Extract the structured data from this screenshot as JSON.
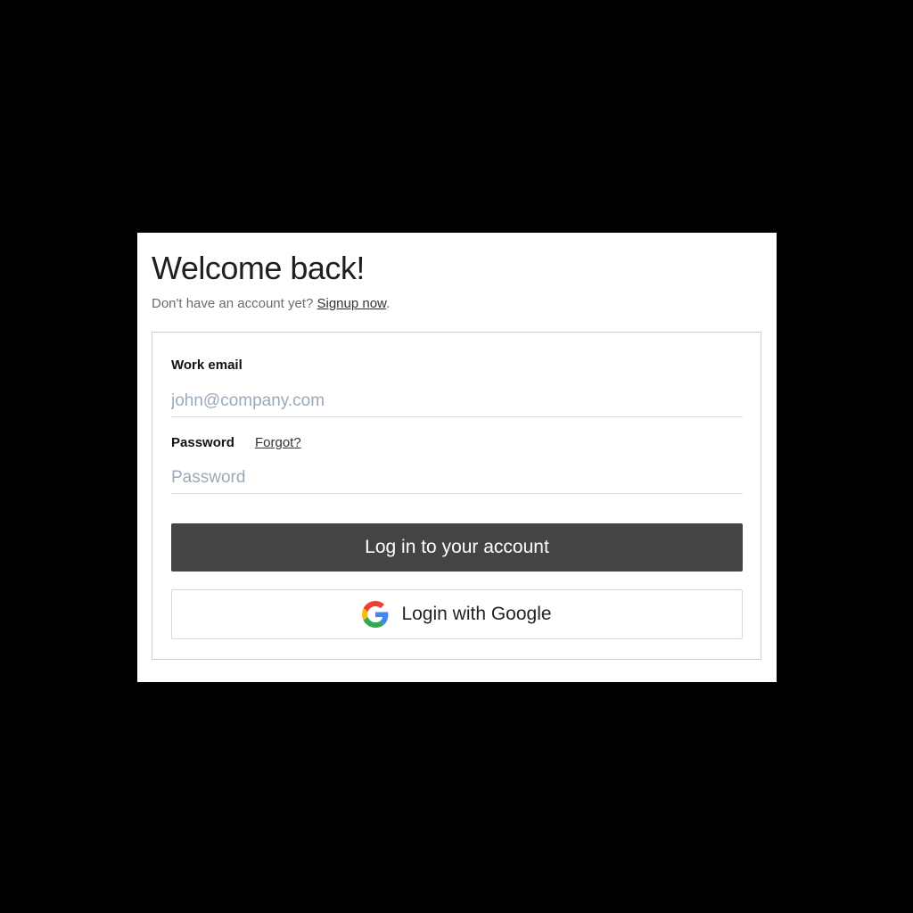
{
  "header": {
    "title": "Welcome back!",
    "subtitle_prefix": "Don't have an account yet? ",
    "signup_link": "Signup now",
    "subtitle_suffix": "."
  },
  "form": {
    "email_label": "Work email",
    "email_placeholder": "john@company.com",
    "email_value": "",
    "password_label": "Password",
    "forgot_link": "Forgot?",
    "password_placeholder": "Password",
    "password_value": "",
    "login_button": "Log in to your account",
    "google_button": "Login with Google"
  },
  "icons": {
    "google": "google-g-icon"
  },
  "colors": {
    "background": "#000000",
    "panel": "#ffffff",
    "primary_button": "#444444",
    "placeholder": "#9aaab9",
    "google_blue": "#4285F4",
    "google_red": "#EA4335",
    "google_yellow": "#FBBC05",
    "google_green": "#34A853"
  }
}
